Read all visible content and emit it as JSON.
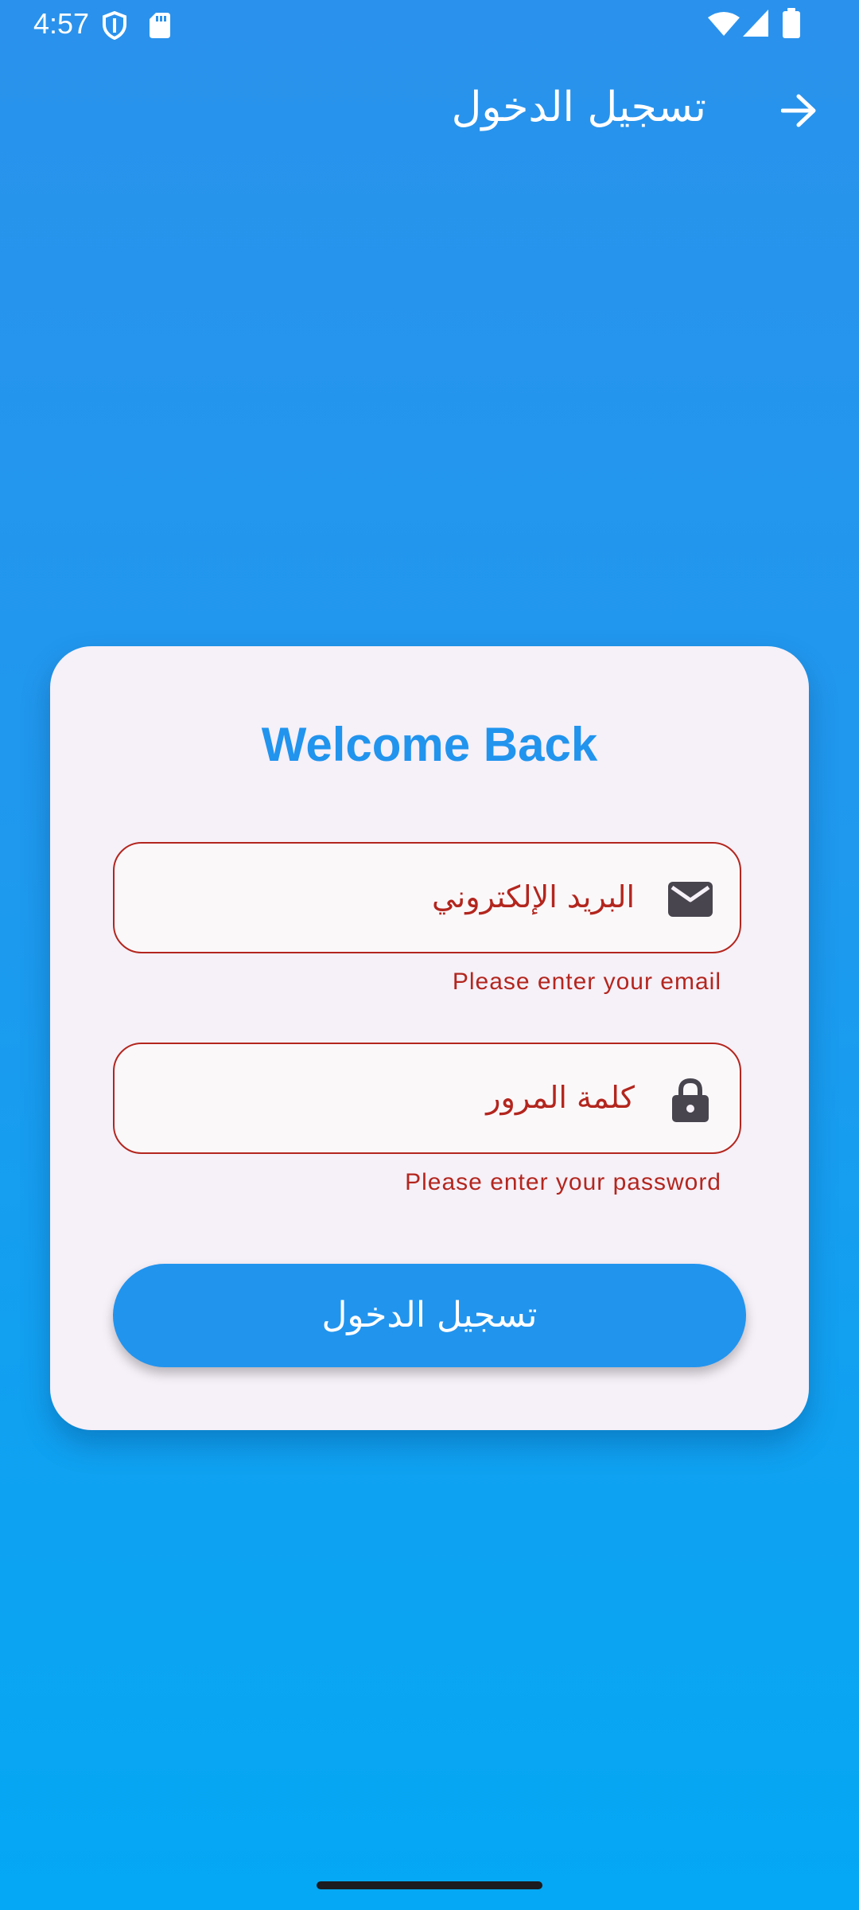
{
  "status_bar": {
    "time": "4:57",
    "left_icons": [
      "shield-icon",
      "sd-card-icon"
    ],
    "right_icons": [
      "wifi-icon",
      "signal-icon",
      "battery-icon"
    ]
  },
  "app_bar": {
    "title": "تسجيل الدخول",
    "action_icon": "arrow-forward-icon"
  },
  "card": {
    "title": "Welcome Back",
    "email_field": {
      "label": "البريد الإلكتروني",
      "icon": "mail-icon",
      "value": "",
      "error": "Please enter your email"
    },
    "password_field": {
      "label": "كلمة المرور",
      "icon": "lock-icon",
      "value": "",
      "error": "Please enter your password"
    },
    "login_button": {
      "label": "تسجيل الدخول"
    }
  },
  "colors": {
    "primary": "#2194ee",
    "error": "#b3261e",
    "card_background": "#f6f0f8",
    "background_top": "#2a92ec",
    "background_bottom": "#04a8f4"
  }
}
